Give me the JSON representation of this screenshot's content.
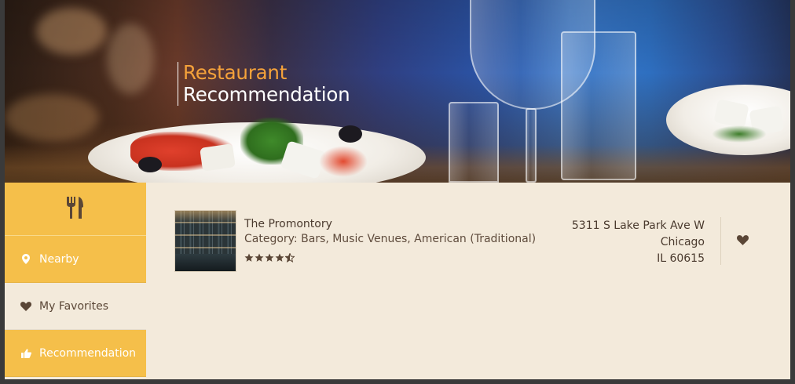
{
  "banner": {
    "title_line1": "Restaurant",
    "title_line2": "Recommendation"
  },
  "sidebar": {
    "logo_icon": "fork-knife-icon",
    "items": [
      {
        "label": "Nearby",
        "icon": "map-pin-icon",
        "state": "default"
      },
      {
        "label": "My Favorites",
        "icon": "heart-icon",
        "state": "selected"
      },
      {
        "label": "Recommendation",
        "icon": "thumbs-up-icon",
        "state": "default"
      }
    ]
  },
  "listing": {
    "name": "The Promontory",
    "category": "Category: Bars, Music Venues, American (Traditional)",
    "rating": 4.5,
    "address_line1": "5311 S Lake Park Ave W",
    "address_line2": "Chicago",
    "address_line3": "IL 60615",
    "favorite_icon": "heart-icon"
  },
  "colors": {
    "accent_yellow": "#f5bf4a",
    "title_orange": "#f5a23a",
    "brown": "#5a4636",
    "background": "#f3eadb"
  }
}
